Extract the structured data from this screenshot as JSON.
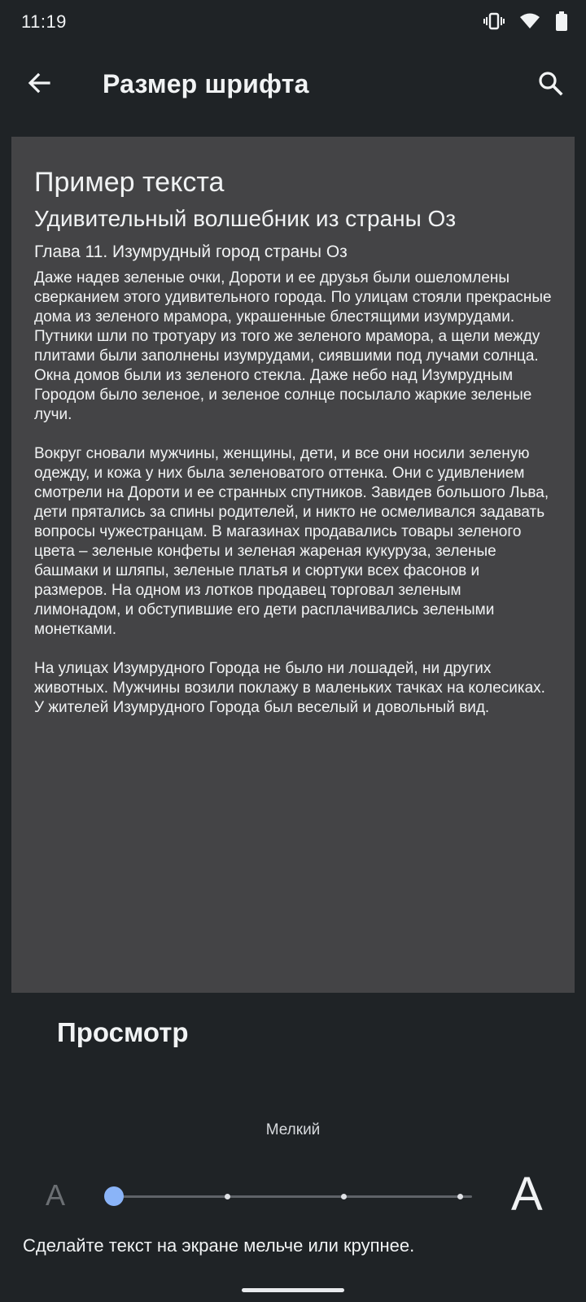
{
  "status_bar": {
    "time": "11:19",
    "icons": [
      "vibrate-icon",
      "wifi-icon",
      "battery-icon"
    ]
  },
  "app_bar": {
    "title": "Размер шрифта",
    "back_icon": "arrow-back-icon",
    "search_icon": "search-icon"
  },
  "preview": {
    "heading": "Пример текста",
    "book_title": "Удивительный волшебник из страны Оз",
    "chapter": "Глава 11. Изумрудный город страны Оз",
    "paragraphs": [
      "Даже надев зеленые очки, Дороти и ее друзья были ошеломлены сверканием этого удивительного города. По улицам стояли прекрасные дома из зеленого мрамора, украшенные блестящими изумрудами. Путники шли по тротуару из того же зеленого мрамора, а щели между плитами были заполнены изумрудами, сиявшими под лучами солнца. Окна домов были из зеленого стекла. Даже небо над Изумрудным Городом было зеленое, и зеленое солнце посылало жаркие зеленые лучи.",
      "Вокруг сновали мужчины, женщины, дети, и все они носили зеленую одежду, и кожа у них была зеленоватого оттенка. Они с удивлением смотрели на Дороти и ее странных спутников. Завидев большого Льва, дети прятались за спины родителей, и никто не осмеливался задавать вопросы чужестранцам. В магазинах продавались товары зеленого цвета – зеленые конфеты и зеленая жареная кукуруза, зеленые башмаки и шляпы, зеленые платья и сюртуки всех фасонов и размеров. На одном из лотков продавец торговал зеленым лимонадом, и обступившие его дети расплачивались зелеными монетками.",
      "На улицах Изумрудного Города не было ни лошадей, ни других животных. Мужчины возили поклажу в маленьких тачках на колесиках. У жителей Изумрудного Города был веселый и довольный вид."
    ]
  },
  "preview_label": "Просмотр",
  "font_size": {
    "current_label": "Мелкий",
    "small_glyph": "A",
    "large_glyph": "A",
    "level": 1,
    "levels": 4
  },
  "hint": "Сделайте текст на экране мельче или крупнее.",
  "colors": {
    "background": "#1f2326",
    "card": "#444446",
    "accent": "#8ab4f8"
  }
}
